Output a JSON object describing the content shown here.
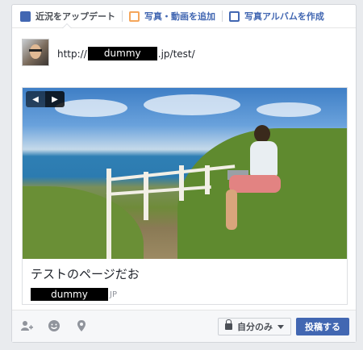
{
  "tabs": {
    "status": "近況をアップデート",
    "photo": "写真・動画を追加",
    "album": "写真アルバムを作成"
  },
  "status": {
    "url_prefix": "http://",
    "url_redacted": "dummy",
    "url_suffix": ".jp/test/"
  },
  "preview": {
    "title": "テストのページだお",
    "domain_redacted": "dummy",
    "domain_suffix": "JP",
    "nav_prev": "◀",
    "nav_next": "▶"
  },
  "footer": {
    "privacy_label": "自分のみ",
    "post_label": "投稿する",
    "icons": [
      "tag-friends-icon",
      "feeling-icon",
      "location-icon"
    ]
  },
  "colors": {
    "accent": "#4267b2",
    "photo_accent": "#f5a65b",
    "background": "#e9ebee"
  }
}
